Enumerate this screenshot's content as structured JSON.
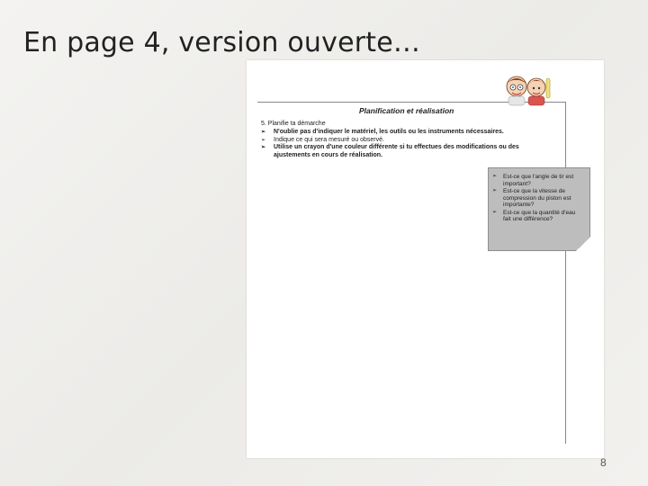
{
  "slide": {
    "title": "En page 4, version ouverte…",
    "number": "8"
  },
  "document": {
    "section_heading": "Planification et réalisation",
    "step_title": "5. Planifie ta démarche",
    "bullets": [
      {
        "text": "N'oublie pas d'indiquer le matériel, les outils ou les instruments nécessaires.",
        "bold": true
      },
      {
        "text": "Indique ce qui sera mesuré ou observé.",
        "bold": false
      },
      {
        "text": "Utilise un crayon d'une couleur différente si tu effectues des modifications ou des ajustements en cours de réalisation.",
        "bold": true
      }
    ],
    "note_card": {
      "items": [
        "Est-ce que l'angle de tir est important?",
        "Est-ce que la vitesse de compression du piston est importante?",
        "Est-ce que la quantité d'eau fait une différence?"
      ]
    },
    "mascot_icon": "scientist-mascots-icon",
    "colors": {
      "note_bg": "#bdbdbd",
      "rule": "#888888"
    }
  }
}
